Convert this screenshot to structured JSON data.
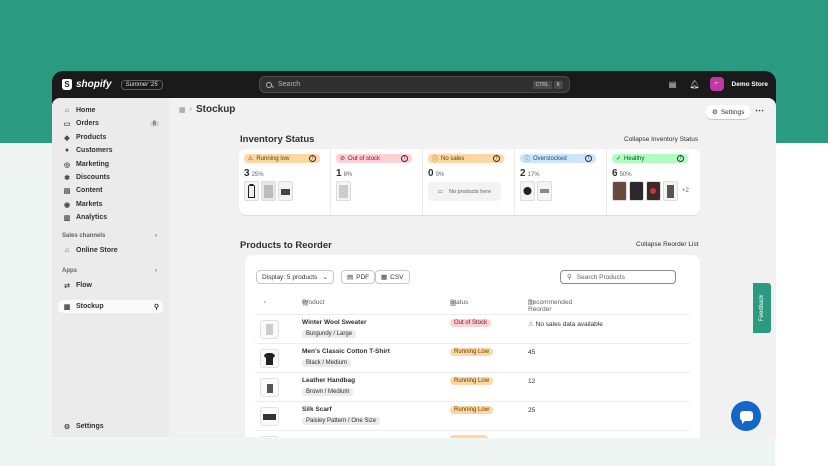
{
  "topbar": {
    "brand": "shopify",
    "edition": "Summer '25",
    "search_placeholder": "Search",
    "kbd": [
      "CTRL",
      "K"
    ],
    "store_avatar": "⌐",
    "store_name": "Demo Store"
  },
  "sidebar": {
    "items": [
      {
        "label": "Home",
        "icon": "home-icon",
        "glyph": "⌂"
      },
      {
        "label": "Orders",
        "icon": "orders-icon",
        "glyph": "▭",
        "badge": "8"
      },
      {
        "label": "Products",
        "icon": "tag-icon",
        "glyph": "◆"
      },
      {
        "label": "Customers",
        "icon": "person-icon",
        "glyph": "●"
      },
      {
        "label": "Marketing",
        "icon": "target-icon",
        "glyph": "◎"
      },
      {
        "label": "Discounts",
        "icon": "discount-icon",
        "glyph": "✱"
      },
      {
        "label": "Content",
        "icon": "content-icon",
        "glyph": "▤"
      },
      {
        "label": "Markets",
        "icon": "globe-icon",
        "glyph": "◉"
      },
      {
        "label": "Analytics",
        "icon": "chart-icon",
        "glyph": "▥"
      }
    ],
    "sales_channels_label": "Sales channels",
    "online_store": "Online Store",
    "apps_label": "Apps",
    "flow": "Flow",
    "stockup": "Stockup",
    "settings": "Settings"
  },
  "page": {
    "title": "Stockup",
    "settings_button": "Settings"
  },
  "inventory": {
    "title": "Inventory Status",
    "collapse": "Collapse Inventory Status",
    "cards": [
      {
        "label": "Running low",
        "icon": "⚠",
        "count": "3",
        "pct": "25%",
        "bg": "#ffd6a4",
        "fg": "#5e4200"
      },
      {
        "label": "Out of stock",
        "icon": "⊘",
        "count": "1",
        "pct": "8%",
        "bg": "#fed1d7",
        "fg": "#8e0b21"
      },
      {
        "label": "No sales",
        "icon": "!",
        "count": "0",
        "pct": "0%",
        "bg": "#ffd6a4",
        "fg": "#5e4200",
        "empty_text": "No products here"
      },
      {
        "label": "Overstocked",
        "icon": "i",
        "count": "2",
        "pct": "17%",
        "bg": "#cfe5fb",
        "fg": "#00527c"
      },
      {
        "label": "Healthy",
        "icon": "✓",
        "count": "6",
        "pct": "50%",
        "bg": "#affebf",
        "fg": "#014b40",
        "more": "+2"
      }
    ]
  },
  "reorder": {
    "title": "Products to Reorder",
    "collapse": "Collapse Reorder List",
    "display": "Display: 5 products",
    "pdf": "PDF",
    "csv": "CSV",
    "search_placeholder": "Search Products",
    "headers": {
      "product": "Product",
      "status": "Status",
      "reorder": "Recommended Reorder"
    },
    "rows": [
      {
        "name": "Winter Wool Sweater",
        "variant": "Burgundy / Large",
        "status": "Out of Stock",
        "status_bg": "#fed1d7",
        "status_fg": "#8e0b21",
        "reorder": "No sales data available",
        "warn": "⚠"
      },
      {
        "name": "Men's Classic Cotton T-Shirt",
        "variant": "Black / Medium",
        "status": "Running Low",
        "status_bg": "#ffd6a4",
        "status_fg": "#5e4200",
        "reorder": "45"
      },
      {
        "name": "Leather Handbag",
        "variant": "Brown / Medium",
        "status": "Running Low",
        "status_bg": "#ffd6a4",
        "status_fg": "#5e4200",
        "reorder": "12"
      },
      {
        "name": "Silk Scarf",
        "variant": "Paisley Pattern / One Size",
        "status": "Running Low",
        "status_bg": "#ffd6a4",
        "status_fg": "#5e4200",
        "reorder": "25"
      }
    ]
  },
  "feedback": "Feedback"
}
